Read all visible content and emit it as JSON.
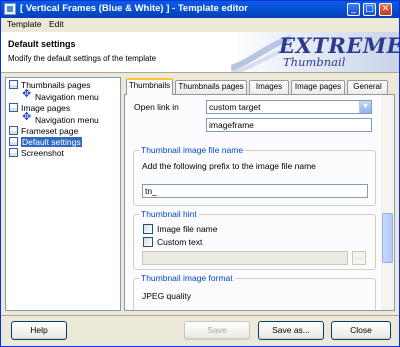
{
  "window": {
    "title": "[ Vertical Frames (Blue & White) ] - Template editor",
    "controls": {
      "minimize": "_",
      "maximize": "□",
      "close": "✕"
    }
  },
  "menu": {
    "items": [
      "Template",
      "Edit"
    ]
  },
  "header": {
    "title": "Default settings",
    "subtitle": "Modify the default settings of the template",
    "logo_line1": "EXTREME",
    "logo_line2": "Thumbnail Generator"
  },
  "tree": {
    "items": [
      {
        "label": "Thumbnails pages",
        "icon": "page-icon"
      },
      {
        "label": "Navigation menu",
        "icon": "navigation-icon"
      },
      {
        "label": "Image pages",
        "icon": "page-icon"
      },
      {
        "label": "Navigation menu",
        "icon": "navigation-icon"
      },
      {
        "label": "Frameset page",
        "icon": "page-icon"
      },
      {
        "label": "Default settings",
        "icon": "page-icon"
      },
      {
        "label": "Screenshot",
        "icon": "page-icon"
      }
    ],
    "selected_index": 5
  },
  "tabs": {
    "items": [
      "Thumbnails",
      "Thumbnails pages",
      "Images",
      "Image pages",
      "General"
    ],
    "active_index": 0
  },
  "form": {
    "open_link_label": "Open link in",
    "open_link_value": "custom target",
    "target_value": "imageframe",
    "prefix_group_title": "Thumbnail image file name",
    "prefix_desc": "Add the following prefix to the image file name",
    "prefix_value": "tn_",
    "hint_group_title": "Thumbnail hint",
    "hint_filename_label": "Image file name",
    "hint_custom_label": "Custom text",
    "hint_custom_value": "",
    "ellipsis": "...",
    "format_group_title": "Thumbnail image format",
    "jpeg_quality_label": "JPEG quality"
  },
  "buttons": {
    "help": "Help",
    "save": "Save",
    "save_as": "Save as...",
    "close": "Close"
  },
  "colors": {
    "titlebar": "#0854d8",
    "selection": "#316ac5",
    "group_title": "#0046d5",
    "logo_text": "#2b3a8c"
  }
}
